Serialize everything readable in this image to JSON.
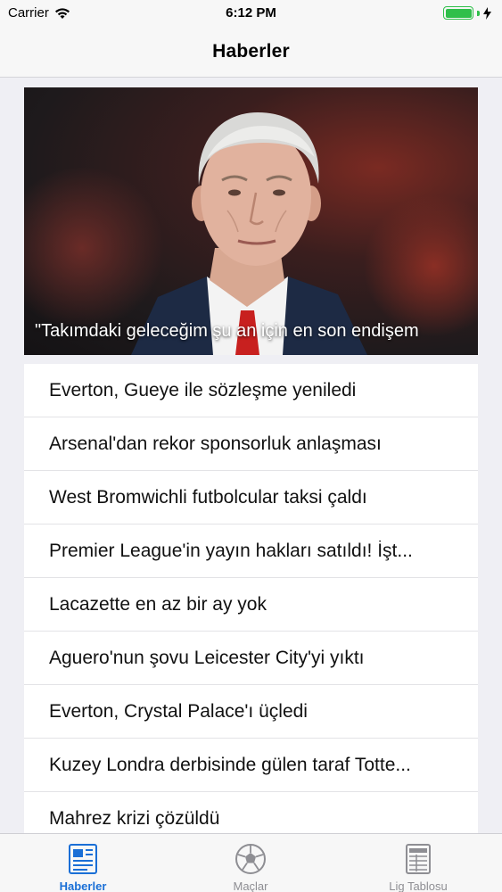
{
  "status_bar": {
    "carrier": "Carrier",
    "time": "6:12 PM"
  },
  "nav": {
    "title": "Haberler"
  },
  "hero": {
    "caption": "\"Takımdaki geleceğim şu an için en son endişem"
  },
  "news": [
    "Everton, Gueye ile sözleşme yeniledi",
    "Arsenal'dan rekor sponsorluk anlaşması",
    "West Bromwichli futbolcular taksi çaldı",
    "Premier League'in yayın hakları satıldı! İşt...",
    "Lacazette en az bir ay yok",
    "Aguero'nun şovu Leicester City'yi yıktı",
    "Everton, Crystal Palace'ı üçledi",
    "Kuzey Londra derbisinde gülen taraf Totte...",
    "Mahrez krizi çözüldü"
  ],
  "tabs": [
    {
      "label": "Haberler",
      "icon": "newspaper-icon",
      "active": true
    },
    {
      "label": "Maçlar",
      "icon": "soccer-ball-icon",
      "active": false
    },
    {
      "label": "Lig Tablosu",
      "icon": "scoreboard-icon",
      "active": false
    }
  ],
  "colors": {
    "accent": "#1a6fd6",
    "battery": "#2fbf4a",
    "inactive": "#8e8e93"
  }
}
